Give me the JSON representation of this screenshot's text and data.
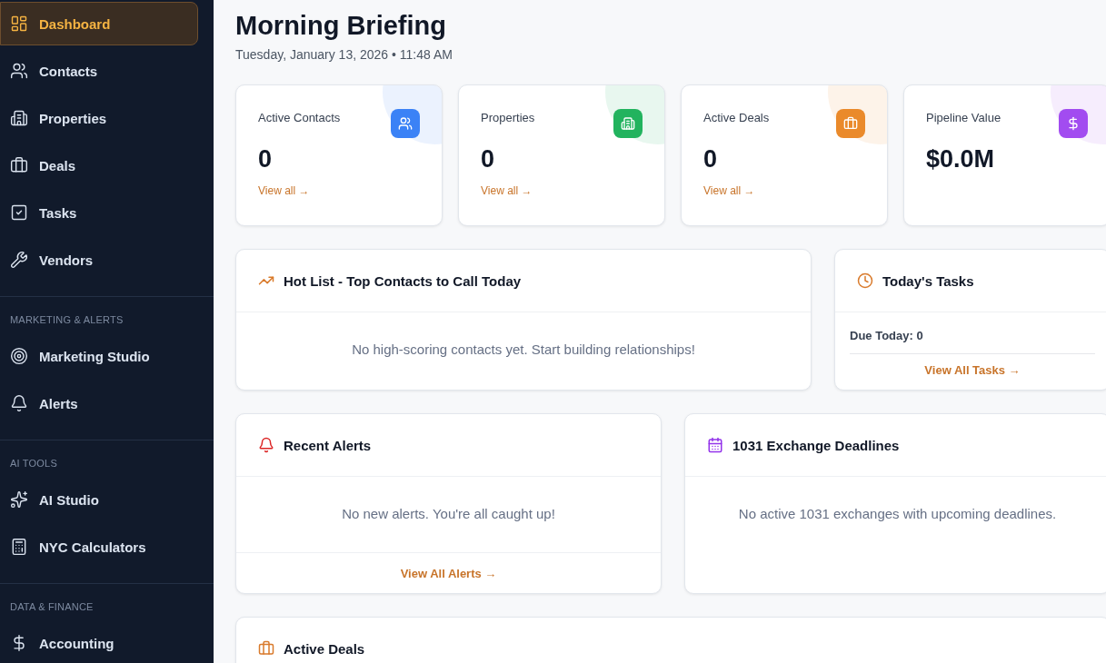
{
  "sidebar": {
    "sections": [
      {
        "items": [
          {
            "label": "Dashboard",
            "selected": true
          },
          {
            "label": "Contacts",
            "selected": false
          },
          {
            "label": "Properties",
            "selected": false
          },
          {
            "label": "Deals",
            "selected": false
          },
          {
            "label": "Tasks",
            "selected": false
          },
          {
            "label": "Vendors",
            "selected": false
          }
        ]
      },
      {
        "label": "MARKETING & ALERTS",
        "items": [
          {
            "label": "Marketing Studio",
            "selected": false
          },
          {
            "label": "Alerts",
            "selected": false
          }
        ]
      },
      {
        "label": "AI TOOLS",
        "items": [
          {
            "label": "AI Studio",
            "selected": false
          },
          {
            "label": "NYC Calculators",
            "selected": false
          }
        ]
      },
      {
        "label": "DATA & FINANCE",
        "items": [
          {
            "label": "Accounting",
            "selected": false
          }
        ]
      }
    ]
  },
  "header": {
    "title": "Morning Briefing",
    "date": "Tuesday, January 13, 2026 • 11:48 AM"
  },
  "stats": [
    {
      "title": "Active Contacts",
      "value": "0",
      "link": "View all →",
      "color": "#3b82f6"
    },
    {
      "title": "Properties",
      "value": "0",
      "link": "View all →",
      "color": "#22b35e"
    },
    {
      "title": "Active Deals",
      "value": "0",
      "link": "View all →",
      "color": "#ea8a2b"
    },
    {
      "title": "Pipeline Value",
      "value": "$0.0M",
      "color": "#a24cf0"
    }
  ],
  "panels": [
    {
      "kind": "hotlist",
      "title": "Hot List - Top Contacts to Call Today",
      "color": "#d97a2b",
      "message": "No high-scoring contacts yet. Start building relationships!"
    },
    {
      "kind": "tasks",
      "title": "Today's Tasks",
      "color": "#d97a2b",
      "due": "Due Today: 0",
      "link": "View All Tasks →"
    },
    {
      "kind": "alerts",
      "title": "Recent Alerts",
      "color": "#dc2626",
      "message": "No new alerts. You're all caught up!",
      "link": "View All Alerts →"
    },
    {
      "kind": "exchange",
      "title": "1031 Exchange Deadlines",
      "color": "#9333ea",
      "message": "No active 1031 exchanges with upcoming deadlines."
    },
    {
      "kind": "deals",
      "title": "Active Deals",
      "color": "#d97a2b"
    }
  ]
}
